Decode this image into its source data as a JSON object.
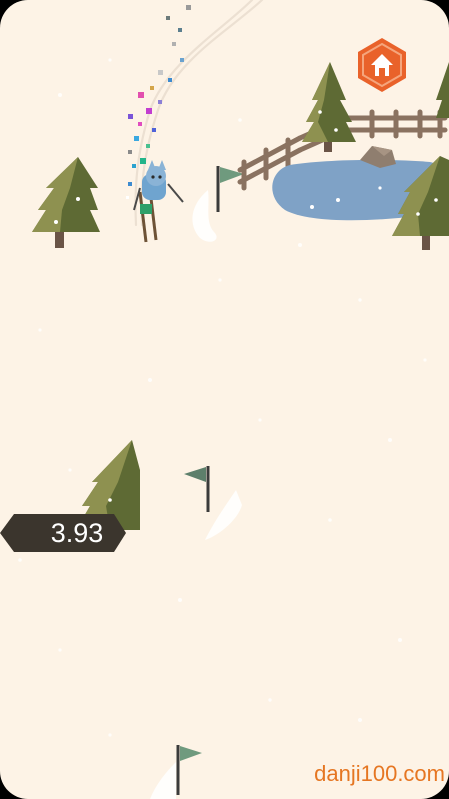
{
  "game": {
    "timer": "3.93",
    "watermark": "danji100.com"
  },
  "icons": {
    "home": "home-icon",
    "home_button_color": "#e9622a",
    "timer_badge_color": "#3b352d"
  },
  "colors": {
    "snow": "#fdf3e6",
    "tree_dark": "#5e6a34",
    "tree_light": "#8e9150",
    "lake": "#7fa2c6",
    "fence": "#8a7260",
    "flag": "#6f9a7e"
  }
}
